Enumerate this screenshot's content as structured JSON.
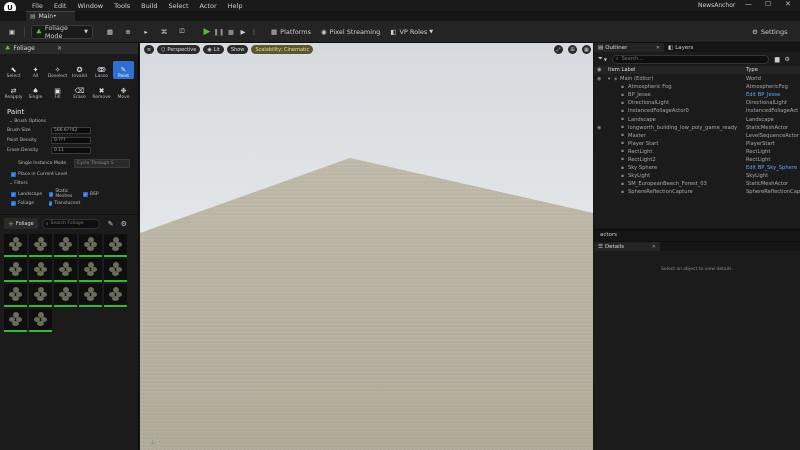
{
  "menu": {
    "items": [
      "File",
      "Edit",
      "Window",
      "Tools",
      "Build",
      "Select",
      "Actor",
      "Help"
    ],
    "project_name": "NewsAnchor"
  },
  "tabs": {
    "level_tab": "Main•"
  },
  "toolbar": {
    "mode_label": "Foliage Mode",
    "platforms_label": "Platforms",
    "streaming_label": "Pixel Streaming",
    "vp_roles_label": "VP Roles",
    "settings_label": "Settings"
  },
  "foliage_panel": {
    "tab_label": "Foliage",
    "tools_row1": [
      {
        "label": "Select",
        "icon": "cursor-icon",
        "glyph": "⬉"
      },
      {
        "label": "All",
        "icon": "select-all-icon",
        "glyph": "✦"
      },
      {
        "label": "Deselect",
        "icon": "deselect-icon",
        "glyph": "✧"
      },
      {
        "label": "Invalid",
        "icon": "invalid-icon",
        "glyph": "✪"
      },
      {
        "label": "Lasso",
        "icon": "lasso-icon",
        "glyph": "ↂ"
      },
      {
        "label": "Paint",
        "icon": "paint-brush-icon",
        "glyph": "✎"
      }
    ],
    "tools_row2": [
      {
        "label": "Reapply",
        "icon": "reapply-icon",
        "glyph": "⇄"
      },
      {
        "label": "Single",
        "icon": "single-icon",
        "glyph": "♠"
      },
      {
        "label": "Fill",
        "icon": "fill-icon",
        "glyph": "▣"
      },
      {
        "label": "Erase",
        "icon": "erase-icon",
        "glyph": "⌫"
      },
      {
        "label": "Remove",
        "icon": "remove-icon",
        "glyph": "✖"
      },
      {
        "label": "Move",
        "icon": "move-icon",
        "glyph": "✥"
      }
    ],
    "paint_title": "Paint",
    "brush_options": "Brush Options",
    "brush_size_label": "Brush Size",
    "brush_size_value": "566.6??42",
    "paint_density_label": "Paint Density",
    "paint_density_value": "0.???",
    "erase_density_label": "Erase Density",
    "erase_density_value": "0.11",
    "single_instance_label": "Single Instance Mode",
    "single_instance_value": "Cycle Through S",
    "place_current_level": "Place in Current Level",
    "filters_label": "Filters",
    "filters": [
      "Landscape",
      "Static Meshes",
      "BSP",
      "Foliage",
      "Translucent"
    ],
    "add_foliage_label": "Foliage",
    "search_placeholder": "Search Foliage",
    "thumb_count": 17
  },
  "viewport": {
    "perspective_label": "Perspective",
    "lit_label": "Lit",
    "show_label": "Show",
    "scalability_label": "Scalability: Cinematic"
  },
  "outliner": {
    "tab_label": "Outliner",
    "layers_label": "Layers",
    "search_placeholder": "Search...",
    "col_item": "Item Label",
    "col_type": "Type",
    "rows": [
      {
        "label": "Main (Editor)",
        "type": "World",
        "link": false,
        "indent": 0
      },
      {
        "label": "Atmospheric Fog",
        "type": "AtmosphericFog",
        "link": false,
        "indent": 1
      },
      {
        "label": "BP_Jesse",
        "type": "Edit BP_Jesse",
        "link": true,
        "indent": 1
      },
      {
        "label": "DirectionalLight",
        "type": "DirectionalLight",
        "link": false,
        "indent": 1
      },
      {
        "label": "InstancedFoliageActor0",
        "type": "InstancedFoliageAct",
        "link": false,
        "indent": 1
      },
      {
        "label": "Landscape",
        "type": "Landscape",
        "link": false,
        "indent": 1
      },
      {
        "label": "longworth_building_low_poly_game_ready",
        "type": "StaticMeshActor",
        "link": false,
        "indent": 1
      },
      {
        "label": "Master",
        "type": "LevelSequenceActor",
        "link": false,
        "indent": 1
      },
      {
        "label": "Player Start",
        "type": "PlayerStart",
        "link": false,
        "indent": 1
      },
      {
        "label": "RectLight",
        "type": "RectLight",
        "link": false,
        "indent": 1
      },
      {
        "label": "RectLight2",
        "type": "RectLight",
        "link": false,
        "indent": 1
      },
      {
        "label": "Sky Sphere",
        "type": "Edit BP_Sky_Sphere",
        "link": true,
        "indent": 1
      },
      {
        "label": "SkyLight",
        "type": "SkyLight",
        "link": false,
        "indent": 1
      },
      {
        "label": "SM_EuropeanBeech_Forest_03",
        "type": "StaticMeshActor",
        "link": false,
        "indent": 1
      },
      {
        "label": "SphereReflectionCapture",
        "type": "SphereReflectionCap",
        "link": false,
        "indent": 1
      }
    ],
    "actors_footer": "actors"
  },
  "details": {
    "tab_label": "Details",
    "empty_message": "Select an object to view details."
  },
  "colors": {
    "accent": "#2f6fd3",
    "play": "#4fbf3a",
    "link": "#5aa8ff",
    "scalability": "#c9b86a"
  }
}
